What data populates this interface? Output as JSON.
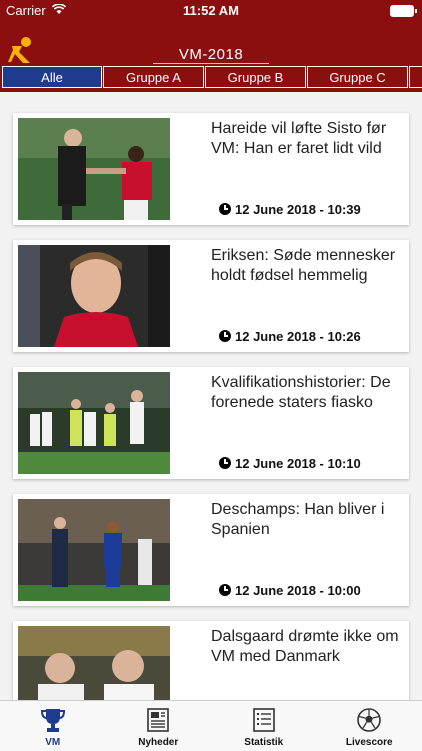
{
  "status_bar": {
    "carrier": "Carrier",
    "time": "11:52 AM"
  },
  "header": {
    "title": "VM-2018"
  },
  "tabs": [
    {
      "label": "Alle",
      "active": true
    },
    {
      "label": "Gruppe A",
      "active": false
    },
    {
      "label": "Gruppe B",
      "active": false
    },
    {
      "label": "Gruppe C",
      "active": false
    },
    {
      "label": "",
      "active": false
    }
  ],
  "articles": [
    {
      "headline": "Hareide vil løfte Sisto før VM: Han er faret lidt vild",
      "date": "12 June 2018 - 10:39"
    },
    {
      "headline": "Eriksen: Søde mennesker holdt fødsel hemmelig",
      "date": "12 June 2018 - 10:26"
    },
    {
      "headline": "Kvalifikationshistorier: De forenede staters fiasko",
      "date": "12 June 2018 - 10:10"
    },
    {
      "headline": "Deschamps: Han bliver i Spanien",
      "date": "12 June 2018 - 10:00"
    },
    {
      "headline": "Dalsgaard drømte ikke om VM med Danmark",
      "date": ""
    }
  ],
  "bottom_nav": [
    {
      "label": "VM",
      "icon": "trophy-icon",
      "active": true
    },
    {
      "label": "Nyheder",
      "icon": "newspaper-icon",
      "active": false
    },
    {
      "label": "Statistik",
      "icon": "list-icon",
      "active": false
    },
    {
      "label": "Livescore",
      "icon": "soccer-ball-icon",
      "active": false
    }
  ],
  "colors": {
    "header": "#8c0f0f",
    "accent": "#1f3b8f"
  }
}
